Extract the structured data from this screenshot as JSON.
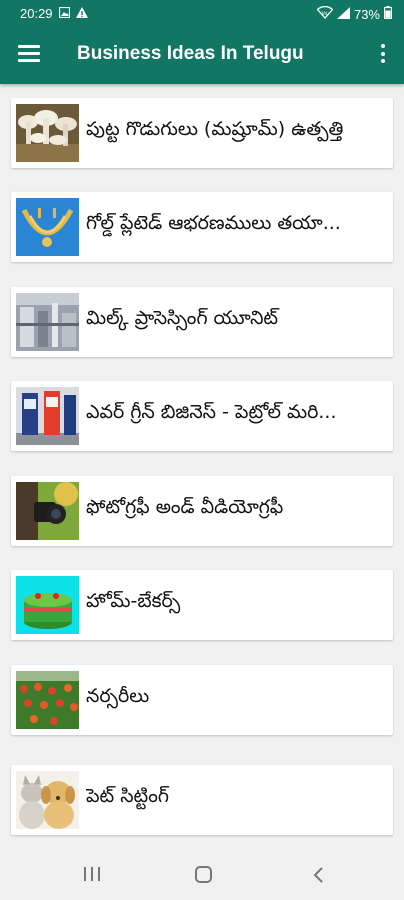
{
  "status_bar": {
    "time": "20:29",
    "battery": "73%",
    "icons": [
      "image-icon",
      "warning-icon",
      "wifi-icon",
      "signal-icon",
      "battery-icon"
    ]
  },
  "app_bar": {
    "title": "Business Ideas In Telugu",
    "icons": [
      "hamburger-menu-icon",
      "more-vert-icon"
    ],
    "color": "#127664"
  },
  "items": [
    {
      "label": "పుట్ట గొడుగులు (మష్రూమ్) ఉత్పత్తి",
      "thumb": "mushrooms"
    },
    {
      "label": "గోల్డ్ ప్లేటెడ్ ఆభరణములు తయా...",
      "thumb": "gold-jewellery"
    },
    {
      "label": "మిల్క్ ప్రాసెస్సింగ్ యూనిట్",
      "thumb": "milk-processing"
    },
    {
      "label": "ఎవర్ గ్రీన్ బిజినెస్ - పెట్రోల్ మరి...",
      "thumb": "petrol-pump"
    },
    {
      "label": "ఫోటోగ్రఫీ అండ్ వీడియోగ్రఫీ",
      "thumb": "camera"
    },
    {
      "label": "హోమ్-బేకర్స్",
      "thumb": "cake"
    },
    {
      "label": "నర్సరీలు",
      "thumb": "nursery-plants"
    },
    {
      "label": "పెట్ సిట్టింగ్",
      "thumb": "puppy-kitten"
    }
  ],
  "nav_bar": {
    "icons": [
      "recents-icon",
      "home-icon",
      "back-icon"
    ]
  }
}
